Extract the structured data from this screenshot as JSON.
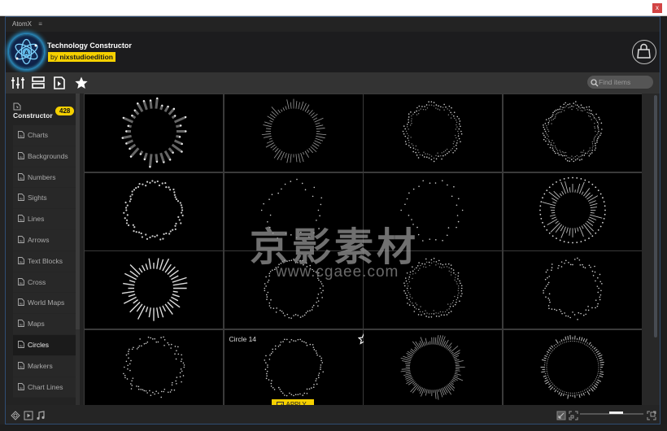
{
  "window": {
    "close_label": "x"
  },
  "panel": {
    "tab_label": "AtomX",
    "menu_icon": "hamburger-icon"
  },
  "header": {
    "title": "Technology Constructor",
    "author_prefix": "by",
    "author_name": "nixstudioedition",
    "logo_icon": "atom-logo-icon",
    "store_icon": "shopping-bag-icon"
  },
  "toolbar": {
    "icons": [
      "sliders-icon",
      "layers-icon",
      "media-file-icon",
      "star-icon"
    ],
    "search": {
      "placeholder": "Find items",
      "value": ""
    }
  },
  "sidebar": {
    "section_label": "Constructor",
    "section_count": "428",
    "items": [
      {
        "label": "Charts",
        "active": false
      },
      {
        "label": "Backgrounds",
        "active": false
      },
      {
        "label": "Numbers",
        "active": false
      },
      {
        "label": "Sights",
        "active": false
      },
      {
        "label": "Lines",
        "active": false
      },
      {
        "label": "Arrows",
        "active": false
      },
      {
        "label": "Text Blocks",
        "active": false
      },
      {
        "label": "Cross",
        "active": false
      },
      {
        "label": "World Maps",
        "active": false
      },
      {
        "label": "Maps",
        "active": false
      },
      {
        "label": "Circles",
        "active": true
      },
      {
        "label": "Markers",
        "active": false
      },
      {
        "label": "Chart Lines",
        "active": false
      }
    ]
  },
  "grid": {
    "hovered": {
      "title": "Circle 14",
      "apply_label": "APPLY"
    },
    "items": [
      {
        "style": "thick-bars"
      },
      {
        "style": "thin-spikes"
      },
      {
        "style": "dot-matrix"
      },
      {
        "style": "wavy-lines"
      },
      {
        "style": "dotted-ring"
      },
      {
        "style": "polygon-dots"
      },
      {
        "style": "polygon-dots"
      },
      {
        "style": "sparse-rays"
      },
      {
        "style": "sun-rays"
      },
      {
        "style": "fine-dots"
      },
      {
        "style": "spike-dots"
      },
      {
        "style": "noisy-ring"
      },
      {
        "style": "scatter-dots"
      },
      {
        "style": "fine-dots"
      },
      {
        "style": "dense-spikes"
      },
      {
        "style": "equalizer-ring"
      }
    ]
  },
  "watermark": {
    "text": "京影素材",
    "url": "www.cgaee.com"
  },
  "footer": {
    "left_icons": [
      "target-icon",
      "play-icon",
      "music-icon"
    ],
    "right_icons": [
      "shrink-icon",
      "grid-small-icon",
      "grid-large-icon"
    ],
    "zoom_level": 0.6
  }
}
